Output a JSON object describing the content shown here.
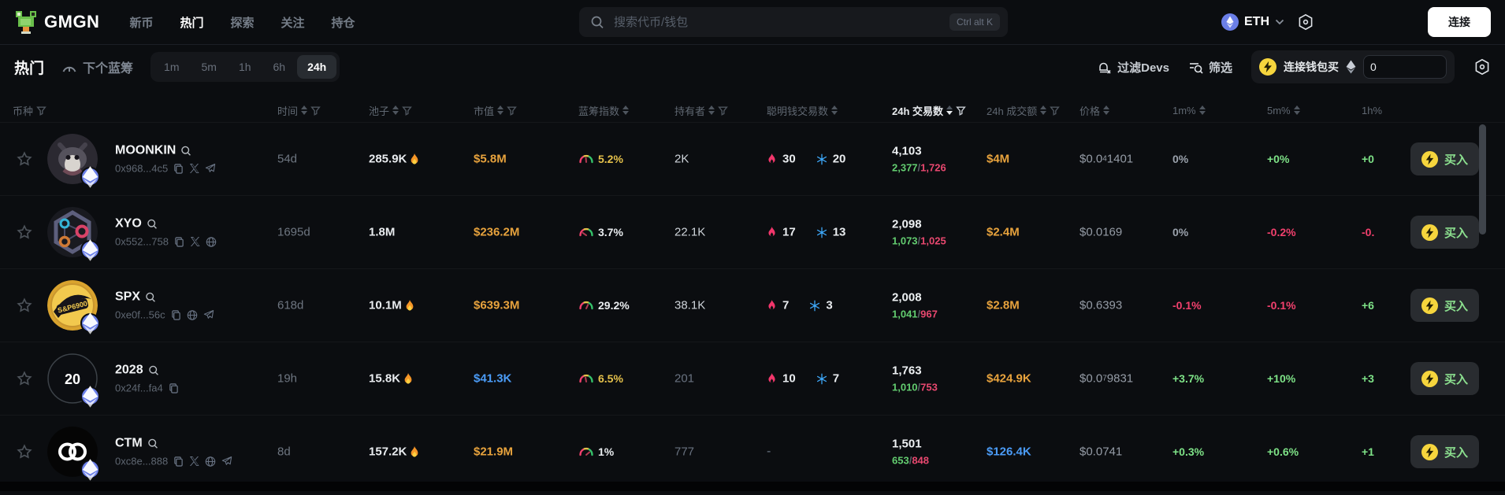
{
  "navbar": {
    "logo_text": "GMGN",
    "nav_items": [
      {
        "label": "新币"
      },
      {
        "label": "热门"
      },
      {
        "label": "探索"
      },
      {
        "label": "关注"
      },
      {
        "label": "持仓"
      }
    ],
    "search": {
      "placeholder": "搜索代币/钱包",
      "shortcut": "Ctrl alt K"
    },
    "chain_label": "ETH",
    "connect_label": "连接"
  },
  "toolbar": {
    "title": "热门",
    "next_bluechip_label": "下个蓝筹",
    "time_tabs": [
      {
        "label": "1m"
      },
      {
        "label": "5m"
      },
      {
        "label": "1h"
      },
      {
        "label": "6h"
      },
      {
        "label": "24h"
      }
    ],
    "active_tab": "24h",
    "filter_devs_label": "过滤Devs",
    "filter_label": "筛选",
    "quick_buy": {
      "label": "连接钱包买",
      "amount": "0"
    }
  },
  "table": {
    "headers": [
      {
        "label": "币种"
      },
      {
        "label": "时间"
      },
      {
        "label": "池子"
      },
      {
        "label": "市值"
      },
      {
        "label": "蓝筹指数"
      },
      {
        "label": "持有者"
      },
      {
        "label": "聪明钱交易数"
      },
      {
        "label": "24h 交易数"
      },
      {
        "label": "24h 成交额"
      },
      {
        "label": "价格"
      },
      {
        "label": "1m%"
      },
      {
        "label": "5m%"
      },
      {
        "label": "1h%"
      }
    ],
    "buy_label": "买入",
    "tokens": [
      {
        "name": "MOONKIN",
        "address": "0x968...4c5",
        "links": [
          "copy",
          "x",
          "telegram"
        ],
        "avatar": "moonkin-creature",
        "avatar_text": "",
        "age": "54d",
        "liquidity": "285.9K",
        "liquidity_hot": true,
        "market_cap": "$5.8M",
        "market_cap_color": "orange",
        "bluechip_pct": "5.2%",
        "bluechip_color": "yellow",
        "holders": "2K",
        "holders_color": "light",
        "smart_buys": "30",
        "smart_sells": "20",
        "smart_dash": "",
        "tx_count": "4,103",
        "tx_buys": "2,377",
        "tx_sells": "1,726",
        "volume": "$4M",
        "volume_color": "orange",
        "price_prefix": "$0.0",
        "price_sub": "4",
        "price_rest": "1401",
        "chg_1m": "0%",
        "chg_1m_color": "gray",
        "chg_5m": "+0%",
        "chg_5m_color": "green",
        "chg_1h": "+0",
        "chg_1h_color": "green"
      },
      {
        "name": "XYO",
        "address": "0x552...758",
        "links": [
          "copy",
          "x",
          "globe"
        ],
        "avatar": "xyo-network",
        "avatar_text": "",
        "age": "1695d",
        "liquidity": "1.8M",
        "liquidity_hot": false,
        "market_cap": "$236.2M",
        "market_cap_color": "orange",
        "bluechip_pct": "3.7%",
        "bluechip_color": "white",
        "holders": "22.1K",
        "holders_color": "light",
        "smart_buys": "17",
        "smart_sells": "13",
        "smart_dash": "",
        "tx_count": "2,098",
        "tx_buys": "1,073",
        "tx_sells": "1,025",
        "volume": "$2.4M",
        "volume_color": "orange",
        "price_prefix": "$0.0169",
        "price_sub": "",
        "price_rest": "",
        "chg_1m": "0%",
        "chg_1m_color": "gray",
        "chg_5m": "-0.2%",
        "chg_5m_color": "red",
        "chg_1h": "-0.",
        "chg_1h_color": "red"
      },
      {
        "name": "SPX",
        "address": "0xe0f...56c",
        "links": [
          "copy",
          "globe",
          "telegram"
        ],
        "avatar": "spx-coin",
        "avatar_text": "S&P6900",
        "age": "618d",
        "liquidity": "10.1M",
        "liquidity_hot": true,
        "market_cap": "$639.3M",
        "market_cap_color": "orange",
        "bluechip_pct": "29.2%",
        "bluechip_color": "white",
        "holders": "38.1K",
        "holders_color": "light",
        "smart_buys": "7",
        "smart_sells": "3",
        "smart_dash": "",
        "tx_count": "2,008",
        "tx_buys": "1,041",
        "tx_sells": "967",
        "volume": "$2.8M",
        "volume_color": "orange",
        "price_prefix": "$0.6393",
        "price_sub": "",
        "price_rest": "",
        "chg_1m": "-0.1%",
        "chg_1m_color": "red",
        "chg_5m": "-0.1%",
        "chg_5m_color": "red",
        "chg_1h": "+6",
        "chg_1h_color": "green"
      },
      {
        "name": "2028",
        "address": "0x24f...fa4",
        "links": [
          "copy"
        ],
        "avatar": "text-badge",
        "avatar_text": "20",
        "age": "19h",
        "liquidity": "15.8K",
        "liquidity_hot": true,
        "market_cap": "$41.3K",
        "market_cap_color": "blue",
        "bluechip_pct": "6.5%",
        "bluechip_color": "yellow",
        "holders": "201",
        "holders_color": "dim",
        "smart_buys": "10",
        "smart_sells": "7",
        "smart_dash": "",
        "tx_count": "1,763",
        "tx_buys": "1,010",
        "tx_sells": "753",
        "volume": "$424.9K",
        "volume_color": "orange",
        "price_prefix": "$0.0",
        "price_sub": "7",
        "price_rest": "9831",
        "chg_1m": "+3.7%",
        "chg_1m_color": "green",
        "chg_5m": "+10%",
        "chg_5m_color": "green",
        "chg_1h": "+3",
        "chg_1h_color": "green"
      },
      {
        "name": "CTM",
        "address": "0xc8e...888",
        "links": [
          "copy",
          "x",
          "globe",
          "telegram"
        ],
        "avatar": "ctm-rings",
        "avatar_text": "",
        "age": "8d",
        "liquidity": "157.2K",
        "liquidity_hot": true,
        "market_cap": "$21.9M",
        "market_cap_color": "orange",
        "bluechip_pct": "1%",
        "bluechip_color": "white",
        "holders": "777",
        "holders_color": "dim",
        "smart_buys": "",
        "smart_sells": "",
        "smart_dash": "-",
        "tx_count": "1,501",
        "tx_buys": "653",
        "tx_sells": "848",
        "volume": "$126.4K",
        "volume_color": "blue",
        "price_prefix": "$0.0741",
        "price_sub": "",
        "price_rest": "",
        "chg_1m": "+0.3%",
        "chg_1m_color": "green",
        "chg_5m": "+0.6%",
        "chg_5m_color": "green",
        "chg_1h": "+1",
        "chg_1h_color": "green"
      }
    ]
  },
  "colors": {
    "accent_orange": "#e8a33d",
    "accent_blue": "#4b9cf7",
    "accent_green": "#7ee287",
    "accent_red": "#f2406d",
    "accent_yellow": "#e5c14b",
    "buy_lightning_yellow": "#f6d53d",
    "eth_badge_blue": "#6b7fe8"
  }
}
